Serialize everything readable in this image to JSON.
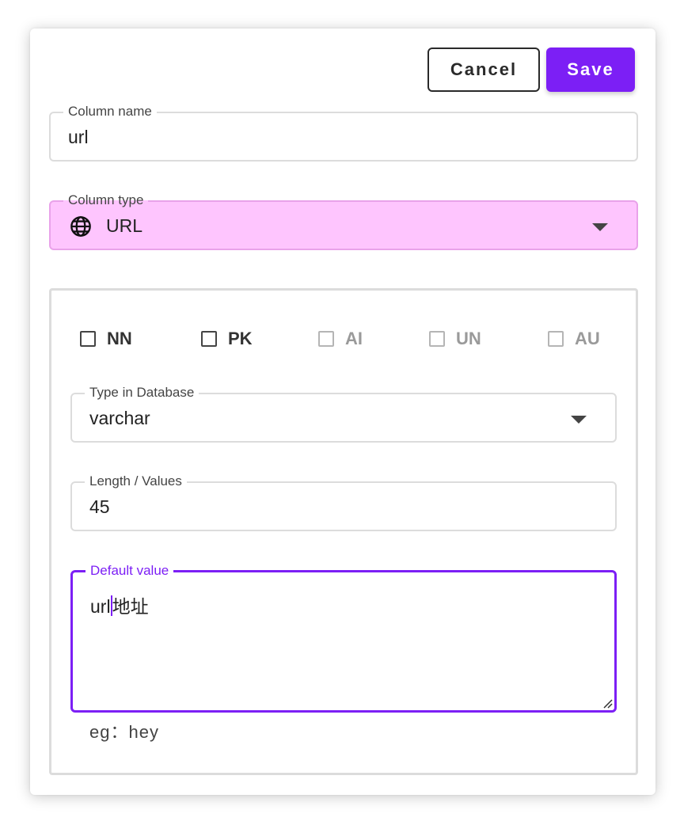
{
  "toolbar": {
    "cancel_label": "Cancel",
    "save_label": "Save"
  },
  "column_name": {
    "label": "Column name",
    "value": "url"
  },
  "column_type": {
    "label": "Column type",
    "value": "URL",
    "icon": "globe-icon",
    "background": "#fec5fe"
  },
  "options": [
    {
      "label": "NN",
      "checked": false,
      "disabled": false
    },
    {
      "label": "PK",
      "checked": false,
      "disabled": false
    },
    {
      "label": "AI",
      "checked": false,
      "disabled": true
    },
    {
      "label": "UN",
      "checked": false,
      "disabled": true
    },
    {
      "label": "AU",
      "checked": false,
      "disabled": true
    }
  ],
  "db_type": {
    "label": "Type in Database",
    "value": "varchar"
  },
  "length": {
    "label": "Length / Values",
    "value": "45"
  },
  "default_value": {
    "label": "Default value",
    "value_before_cursor": "url",
    "value_after_cursor": "地址",
    "helper": "eg：hey"
  },
  "colors": {
    "accent": "#7c1ff5",
    "type_highlight": "#fec5fe"
  }
}
